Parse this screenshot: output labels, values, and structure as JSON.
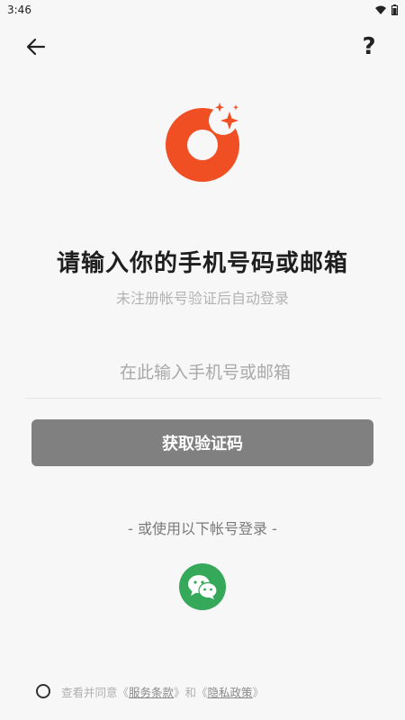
{
  "status_bar": {
    "time": "3:46"
  },
  "header": {
    "help_label": "?"
  },
  "title": "请输入你的手机号码或邮箱",
  "subtitle": "未注册帐号验证后自动登录",
  "input": {
    "placeholder": "在此输入手机号或邮箱",
    "value": ""
  },
  "get_code_button": "获取验证码",
  "alt_login_text": "- 或使用以下帐号登录 -",
  "agreement": {
    "prefix": "查看并同意《",
    "terms_link": "服务条款",
    "middle": "》和《",
    "privacy_link": "隐私政策",
    "suffix": "》"
  },
  "colors": {
    "brand": "#f04e23",
    "button_disabled": "#808080",
    "wechat": "#35a85a"
  },
  "icons": [
    "back-arrow-icon",
    "help-icon",
    "wifi-icon",
    "battery-icon",
    "app-logo-icon",
    "wechat-icon"
  ]
}
